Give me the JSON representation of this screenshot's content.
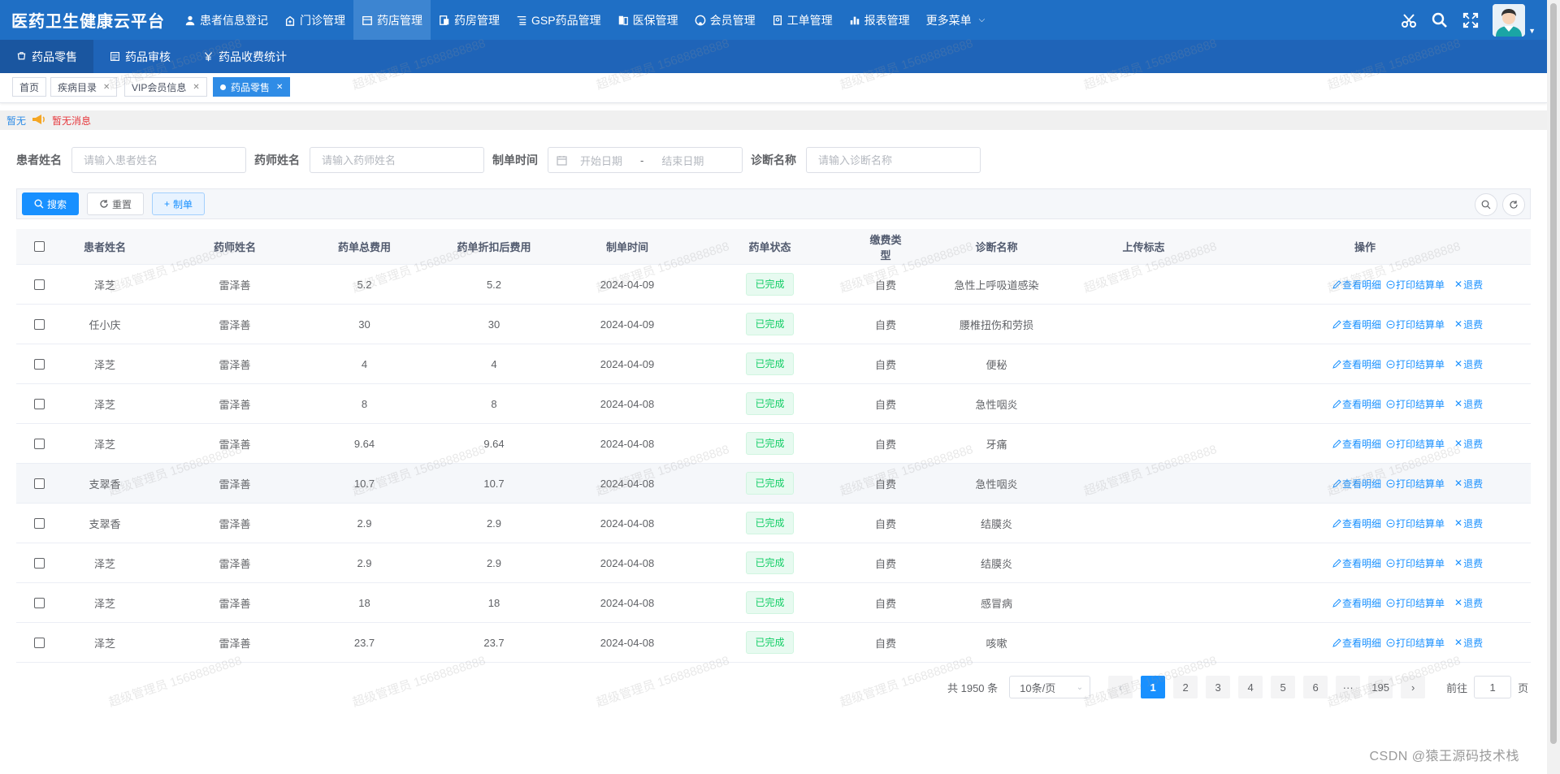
{
  "brand": "医药卫生健康云平台",
  "topnav": [
    {
      "label": "患者信息登记",
      "icon": "user-icon"
    },
    {
      "label": "门诊管理",
      "icon": "clinic-icon"
    },
    {
      "label": "药店管理",
      "icon": "store-icon"
    },
    {
      "label": "药房管理",
      "icon": "pharmacy-icon"
    },
    {
      "label": "GSP药品管理",
      "icon": "list-icon"
    },
    {
      "label": "医保管理",
      "icon": "insurance-icon"
    },
    {
      "label": "会员管理",
      "icon": "github-icon"
    },
    {
      "label": "工单管理",
      "icon": "ticket-icon"
    },
    {
      "label": "报表管理",
      "icon": "chart-icon"
    },
    {
      "label": "更多菜单",
      "icon": "chevron-down-icon"
    }
  ],
  "subnav": [
    {
      "label": "药品零售",
      "icon": "retail-icon"
    },
    {
      "label": "药品审核",
      "icon": "audit-icon"
    },
    {
      "label": "药品收费统计",
      "icon": "yen-icon"
    }
  ],
  "tags": [
    {
      "label": "首页"
    },
    {
      "label": "疾病目录"
    },
    {
      "label": "VIP会员信息"
    },
    {
      "label": "药品零售"
    }
  ],
  "notice": {
    "label": "暂无",
    "message": "暂无消息"
  },
  "filters": {
    "patient_label": "患者姓名",
    "patient_placeholder": "请输入患者姓名",
    "pharmacist_label": "药师姓名",
    "pharmacist_placeholder": "请输入药师姓名",
    "time_label": "制单时间",
    "start_placeholder": "开始日期",
    "range_sep": "-",
    "end_placeholder": "结束日期",
    "diag_label": "诊断名称",
    "diag_placeholder": "请输入诊断名称"
  },
  "toolbar": {
    "search": "搜索",
    "reset": "重置",
    "create": "制单"
  },
  "table": {
    "columns": [
      "患者姓名",
      "药师姓名",
      "药单总费用",
      "药单折扣后费用",
      "制单时间",
      "药单状态",
      "缴费类型",
      "诊断名称",
      "上传标志",
      "操作"
    ],
    "rows": [
      {
        "patient": "泽芝",
        "pharmacist": "雷泽善",
        "total": "5.2",
        "discounted": "5.2",
        "date": "2024-04-09",
        "status": "已完成",
        "pay": "自费",
        "diagnosis": "急性上呼吸道感染",
        "upload": ""
      },
      {
        "patient": "任小庆",
        "pharmacist": "雷泽善",
        "total": "30",
        "discounted": "30",
        "date": "2024-04-09",
        "status": "已完成",
        "pay": "自费",
        "diagnosis": "腰椎扭伤和劳损",
        "upload": ""
      },
      {
        "patient": "泽芝",
        "pharmacist": "雷泽善",
        "total": "4",
        "discounted": "4",
        "date": "2024-04-09",
        "status": "已完成",
        "pay": "自费",
        "diagnosis": "便秘",
        "upload": ""
      },
      {
        "patient": "泽芝",
        "pharmacist": "雷泽善",
        "total": "8",
        "discounted": "8",
        "date": "2024-04-08",
        "status": "已完成",
        "pay": "自费",
        "diagnosis": "急性咽炎",
        "upload": ""
      },
      {
        "patient": "泽芝",
        "pharmacist": "雷泽善",
        "total": "9.64",
        "discounted": "9.64",
        "date": "2024-04-08",
        "status": "已完成",
        "pay": "自费",
        "diagnosis": "牙痛",
        "upload": ""
      },
      {
        "patient": "支翠香",
        "pharmacist": "雷泽善",
        "total": "10.7",
        "discounted": "10.7",
        "date": "2024-04-08",
        "status": "已完成",
        "pay": "自费",
        "diagnosis": "急性咽炎",
        "upload": ""
      },
      {
        "patient": "支翠香",
        "pharmacist": "雷泽善",
        "total": "2.9",
        "discounted": "2.9",
        "date": "2024-04-08",
        "status": "已完成",
        "pay": "自费",
        "diagnosis": "结膜炎",
        "upload": ""
      },
      {
        "patient": "泽芝",
        "pharmacist": "雷泽善",
        "total": "2.9",
        "discounted": "2.9",
        "date": "2024-04-08",
        "status": "已完成",
        "pay": "自费",
        "diagnosis": "结膜炎",
        "upload": ""
      },
      {
        "patient": "泽芝",
        "pharmacist": "雷泽善",
        "total": "18",
        "discounted": "18",
        "date": "2024-04-08",
        "status": "已完成",
        "pay": "自费",
        "diagnosis": "感冒病",
        "upload": ""
      },
      {
        "patient": "泽芝",
        "pharmacist": "雷泽善",
        "total": "23.7",
        "discounted": "23.7",
        "date": "2024-04-08",
        "status": "已完成",
        "pay": "自费",
        "diagnosis": "咳嗽",
        "upload": ""
      }
    ],
    "actions": {
      "detail": "查看明细",
      "print": "打印结算单",
      "refund": "退费"
    }
  },
  "pagination": {
    "total": "共 1950 条",
    "page_size": "10条/页",
    "pages": [
      "1",
      "2",
      "3",
      "4",
      "5",
      "6"
    ],
    "ellipsis": "···",
    "last": "195",
    "goto_prefix": "前往",
    "goto_value": "1",
    "goto_suffix": "页"
  },
  "watermark": "超级管理员 15688888888",
  "footer_mark": "CSDN @猿王源码技术栈",
  "colors": {
    "primary": "#1f6fc5",
    "accent": "#1890ff",
    "success": "#13ce66",
    "danger": "#e6393e"
  }
}
